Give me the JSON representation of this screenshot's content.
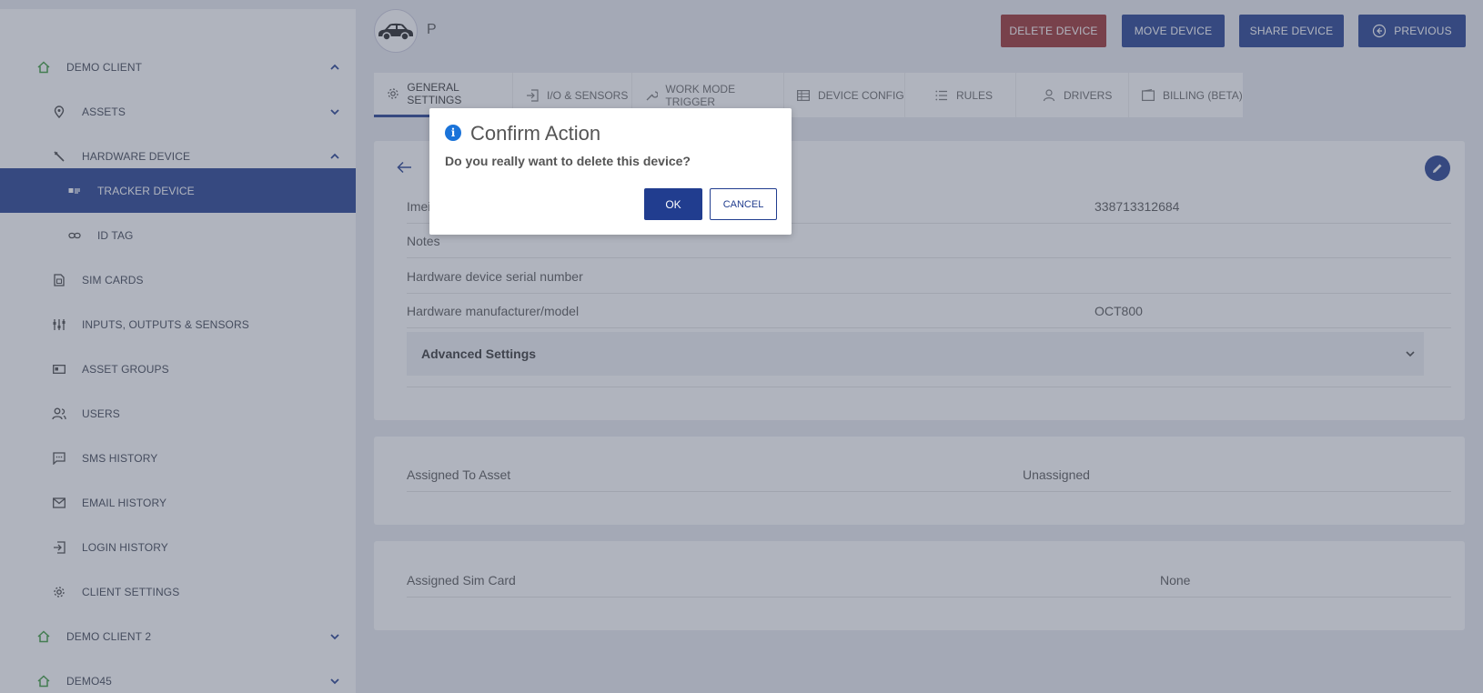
{
  "sidebar": {
    "items": [
      {
        "label": "DEMO CLIENT",
        "icon": "home-icon"
      },
      {
        "label": "ASSETS",
        "icon": "map-pin-icon"
      },
      {
        "label": "HARDWARE DEVICE",
        "icon": "wrench-icon"
      },
      {
        "label": "TRACKER DEVICE",
        "icon": "id-card-icon"
      },
      {
        "label": "ID TAG",
        "icon": "link-icon"
      },
      {
        "label": "SIM CARDS",
        "icon": "sim-card-icon"
      },
      {
        "label": "INPUTS, OUTPUTS & SENSORS",
        "icon": "sliders-icon"
      },
      {
        "label": "ASSET GROUPS",
        "icon": "group-card-icon"
      },
      {
        "label": "USERS",
        "icon": "users-icon"
      },
      {
        "label": "SMS HISTORY",
        "icon": "chat-icon"
      },
      {
        "label": "EMAIL HISTORY",
        "icon": "mail-icon"
      },
      {
        "label": "LOGIN HISTORY",
        "icon": "login-icon"
      },
      {
        "label": "CLIENT SETTINGS",
        "icon": "gear-icon"
      },
      {
        "label": "DEMO CLIENT 2",
        "icon": "home-icon"
      },
      {
        "label": "DEMO45",
        "icon": "home-icon"
      }
    ]
  },
  "header": {
    "device_name": "P",
    "delete_label": "DELETE DEVICE",
    "move_label": "MOVE DEVICE",
    "share_label": "SHARE DEVICE",
    "previous_label": "PREVIOUS"
  },
  "tabs": [
    {
      "label": "GENERAL SETTINGS"
    },
    {
      "label": "I/O & SENSORS"
    },
    {
      "label": "WORK MODE TRIGGER"
    },
    {
      "label": "DEVICE CONFIG"
    },
    {
      "label": "RULES"
    },
    {
      "label": "DRIVERS"
    },
    {
      "label": "BILLING (BETA)"
    }
  ],
  "general": {
    "rows": [
      {
        "key": "Imei",
        "value": "338713312684"
      },
      {
        "key": "Notes",
        "value": ""
      },
      {
        "key": "Hardware device serial number",
        "value": ""
      },
      {
        "key": "Hardware manufacturer/model",
        "value": "OCT800"
      }
    ],
    "advanced_label": "Advanced Settings"
  },
  "asset_card": {
    "key": "Assigned To Asset",
    "value": "Unassigned"
  },
  "sim_card": {
    "key": "Assigned Sim Card",
    "value": "None"
  },
  "modal": {
    "title": "Confirm Action",
    "message": "Do you really want to delete this device?",
    "ok_label": "OK",
    "cancel_label": "CANCEL"
  },
  "colors": {
    "accent": "#213d8f",
    "danger": "#9a2e2e",
    "home_icon": "#3a9a3a",
    "info": "#1a73d9"
  }
}
